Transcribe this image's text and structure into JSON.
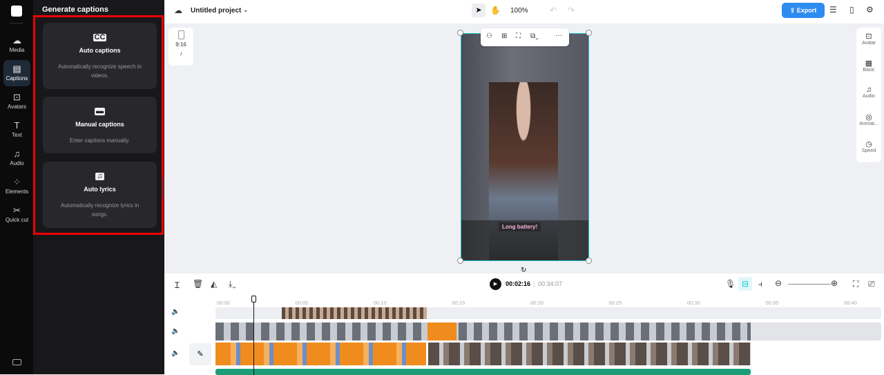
{
  "nav": [
    {
      "label": "Media",
      "icon": "cloud-upload-icon"
    },
    {
      "label": "Captions",
      "icon": "captions-icon"
    },
    {
      "label": "Avatars",
      "icon": "avatar-icon"
    },
    {
      "label": "Text",
      "icon": "text-icon"
    },
    {
      "label": "Audio",
      "icon": "music-icon"
    },
    {
      "label": "Elements",
      "icon": "elements-icon"
    },
    {
      "label": "Quick cut",
      "icon": "quick-cut-icon"
    }
  ],
  "panel": {
    "title": "Generate captions",
    "cards": [
      {
        "title": "Auto captions",
        "desc": "Automatically recognize speech in videos.",
        "icon": "CC"
      },
      {
        "title": "Manual captions",
        "desc": "Enter captions manually.",
        "icon": "▬"
      },
      {
        "title": "Auto lyrics",
        "desc": "Automatically recognize lyrics in songs.",
        "icon": "♫"
      }
    ]
  },
  "topbar": {
    "project": "Untitled project",
    "zoom": "100%",
    "export": "Export"
  },
  "canvas": {
    "ratio": "9:16",
    "caption": "Long battery!"
  },
  "right_panel": [
    {
      "label": "Avatar"
    },
    {
      "label": "Basic"
    },
    {
      "label": "Audio"
    },
    {
      "label": "Animat..."
    },
    {
      "label": "Speed"
    }
  ],
  "timeline": {
    "current": "00:02:16",
    "total": "00:34:07",
    "ticks": [
      "00:00",
      "00:05",
      "00:10",
      "00:15",
      "00:20",
      "00:25",
      "00:30",
      "00:35",
      "00:40"
    ]
  },
  "colors": {
    "accent": "#2d8cf0",
    "selection": "#19c3cf",
    "clip": "#f08c1e",
    "audio": "#1b9e77"
  }
}
